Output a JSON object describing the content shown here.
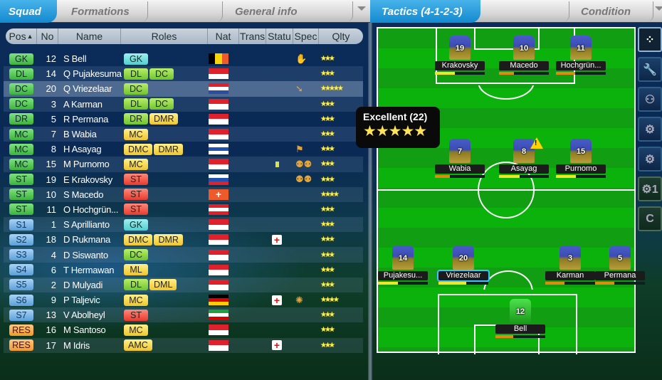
{
  "left_tabs": {
    "squad": "Squad",
    "formations": "Formations",
    "general_info": "General info"
  },
  "columns": [
    "Pos",
    "No",
    "Name",
    "Roles",
    "Nat",
    "Trans",
    "Statu",
    "Spec",
    "Qlty"
  ],
  "players": [
    {
      "pos": "GK",
      "pos_color": "green",
      "no": "12",
      "name": "S Bell",
      "roles": [
        {
          "r": "GK",
          "c": "cyan"
        }
      ],
      "flag": {
        "dir": "v",
        "colors": [
          "#000000",
          "#f8d40a",
          "#ef5a2a"
        ]
      },
      "spec": "gloves-icon",
      "stars": 3
    },
    {
      "pos": "DL",
      "pos_color": "green",
      "no": "14",
      "name": "Q Pujakesuma",
      "roles": [
        {
          "r": "DL",
          "c": "lgreen"
        },
        {
          "r": "DC",
          "c": "lgreen"
        }
      ],
      "flag": {
        "dir": "h",
        "colors": [
          "#e0202a",
          "#ffffff"
        ]
      },
      "stars": 2.5
    },
    {
      "pos": "DC",
      "pos_color": "green",
      "no": "20",
      "name": "Q Vriezelaar",
      "roles": [
        {
          "r": "DC",
          "c": "lgreen"
        }
      ],
      "flag": {
        "dir": "h",
        "colors": [
          "#e0202a",
          "#ffffff",
          "#2a4ea0"
        ]
      },
      "spec": "tackle-icon",
      "stars": 4.5,
      "selected": true
    },
    {
      "pos": "DC",
      "pos_color": "green",
      "no": "3",
      "name": "A Karman",
      "roles": [
        {
          "r": "DL",
          "c": "lgreen"
        },
        {
          "r": "DC",
          "c": "lgreen"
        }
      ],
      "flag": {
        "dir": "h",
        "colors": [
          "#e0202a",
          "#ffffff"
        ]
      },
      "stars": 2.5
    },
    {
      "pos": "DR",
      "pos_color": "green",
      "no": "5",
      "name": "R Permana",
      "roles": [
        {
          "r": "DR",
          "c": "lgreen"
        },
        {
          "r": "DMR",
          "c": "yellow"
        }
      ],
      "flag": {
        "dir": "h",
        "colors": [
          "#e0202a",
          "#ffffff"
        ]
      },
      "stars": 2.5
    },
    {
      "pos": "MC",
      "pos_color": "green",
      "no": "7",
      "name": "B Wabia",
      "roles": [
        {
          "r": "MC",
          "c": "yellow"
        }
      ],
      "flag": {
        "dir": "h",
        "colors": [
          "#e0202a",
          "#ffffff"
        ]
      },
      "stars": 2.5
    },
    {
      "pos": "MC",
      "pos_color": "green",
      "no": "8",
      "name": "H Asayag",
      "roles": [
        {
          "r": "DMC",
          "c": "yellow"
        },
        {
          "r": "DMR",
          "c": "yellow"
        }
      ],
      "flag": {
        "dir": "h",
        "colors": [
          "#ffffff",
          "#2050b0",
          "#ffffff"
        ]
      },
      "spec": "captain-flag-icon",
      "stars": 2.5
    },
    {
      "pos": "MC",
      "pos_color": "green",
      "no": "15",
      "name": "M Purnomo",
      "roles": [
        {
          "r": "MC",
          "c": "yellow"
        }
      ],
      "flag": {
        "dir": "h",
        "colors": [
          "#e0202a",
          "#ffffff"
        ]
      },
      "status": "fitness",
      "spec": "teamwork-icon",
      "stars": 2.5
    },
    {
      "pos": "ST",
      "pos_color": "green",
      "no": "19",
      "name": "E Krakovsky",
      "roles": [
        {
          "r": "ST",
          "c": "red"
        }
      ],
      "flag": {
        "dir": "h",
        "colors": [
          "#ffffff",
          "#2050b0",
          "#e0202a"
        ]
      },
      "spec": "teamwork-icon",
      "stars": 2.5
    },
    {
      "pos": "ST",
      "pos_color": "green",
      "no": "10",
      "name": "S Macedo",
      "roles": [
        {
          "r": "ST",
          "c": "red"
        }
      ],
      "flag": {
        "dir": "h",
        "colors": [
          "#ef5a2a"
        ],
        "cross": true
      },
      "stars": 3.5
    },
    {
      "pos": "ST",
      "pos_color": "green",
      "no": "11",
      "name": "O Hochgrün...",
      "roles": [
        {
          "r": "ST",
          "c": "red"
        }
      ],
      "flag": {
        "dir": "h",
        "colors": [
          "#e0202a",
          "#ffffff",
          "#e0202a"
        ]
      },
      "stars": 2.5
    },
    {
      "pos": "S1",
      "pos_color": "blue",
      "no": "1",
      "name": "S Aprillianto",
      "roles": [
        {
          "r": "GK",
          "c": "cyan"
        }
      ],
      "flag": {
        "dir": "h",
        "colors": [
          "#e0202a",
          "#ffffff"
        ]
      },
      "stars": 2.5
    },
    {
      "pos": "S2",
      "pos_color": "blue",
      "no": "18",
      "name": "D Rukmana",
      "roles": [
        {
          "r": "DMC",
          "c": "yellow"
        },
        {
          "r": "DMR",
          "c": "yellow"
        }
      ],
      "flag": {
        "dir": "h",
        "colors": [
          "#e0202a",
          "#ffffff"
        ]
      },
      "status": "injured",
      "stars": 2.5
    },
    {
      "pos": "S3",
      "pos_color": "blue",
      "no": "4",
      "name": "D Siswanto",
      "roles": [
        {
          "r": "DC",
          "c": "lgreen"
        }
      ],
      "flag": {
        "dir": "h",
        "colors": [
          "#e0202a",
          "#ffffff"
        ]
      },
      "stars": 2.5
    },
    {
      "pos": "S4",
      "pos_color": "blue",
      "no": "6",
      "name": "T Hermawan",
      "roles": [
        {
          "r": "ML",
          "c": "yellow"
        }
      ],
      "flag": {
        "dir": "h",
        "colors": [
          "#e0202a",
          "#ffffff"
        ]
      },
      "stars": 2.5
    },
    {
      "pos": "S5",
      "pos_color": "blue",
      "no": "2",
      "name": "D Mulyadi",
      "roles": [
        {
          "r": "DL",
          "c": "lgreen"
        },
        {
          "r": "DML",
          "c": "yellow"
        }
      ],
      "flag": {
        "dir": "h",
        "colors": [
          "#e0202a",
          "#ffffff"
        ]
      },
      "stars": 2.5
    },
    {
      "pos": "S6",
      "pos_color": "blue",
      "no": "9",
      "name": "P Taljevic",
      "roles": [
        {
          "r": "MC",
          "c": "yellow"
        }
      ],
      "flag": {
        "dir": "h",
        "colors": [
          "#000000",
          "#dd0000",
          "#ffce00"
        ]
      },
      "status": "injured",
      "spec": "star-player-icon",
      "stars": 3.5
    },
    {
      "pos": "S7",
      "pos_color": "blue",
      "no": "13",
      "name": "V Abolheyl",
      "roles": [
        {
          "r": "ST",
          "c": "red"
        }
      ],
      "flag": {
        "dir": "h",
        "colors": [
          "#239f40",
          "#ffffff",
          "#da0000"
        ]
      },
      "stars": 2.5
    },
    {
      "pos": "RES",
      "pos_color": "orange",
      "no": "16",
      "name": "M Santoso",
      "roles": [
        {
          "r": "MC",
          "c": "yellow"
        }
      ],
      "flag": {
        "dir": "h",
        "colors": [
          "#e0202a",
          "#ffffff"
        ]
      },
      "stars": 2.5
    },
    {
      "pos": "RES",
      "pos_color": "orange",
      "no": "17",
      "name": "M Idris",
      "roles": [
        {
          "r": "AMC",
          "c": "yellow"
        }
      ],
      "flag": {
        "dir": "h",
        "colors": [
          "#e0202a",
          "#ffffff"
        ]
      },
      "status": "injured",
      "stars": 2.5
    }
  ],
  "right_tabs": {
    "tactics": "Tactics (4-1-2-3)",
    "condition": "Condition"
  },
  "tooltip": {
    "title": "Excellent (22)",
    "stars": 5
  },
  "pitch_players": [
    {
      "no": "19",
      "name": "Krakovsky",
      "bar": 0.4,
      "bar_color": "#f2e62a",
      "row": 0,
      "col": 0
    },
    {
      "no": "10",
      "name": "Macedo",
      "bar": 0.3,
      "bar_color": "#e08a10",
      "row": 0,
      "col": 1
    },
    {
      "no": "11",
      "name": "Hochgrün...",
      "bar": 0.38,
      "bar_color": "#e08a10",
      "row": 0,
      "col": 2
    },
    {
      "no": "7",
      "name": "Wabia",
      "bar": 0.3,
      "bar_color": "#e08a10",
      "row": 1,
      "col": 0
    },
    {
      "no": "8",
      "name": "Asayag",
      "bar": 0.42,
      "bar_color": "#f2e62a",
      "row": 1,
      "col": 1,
      "warning": true
    },
    {
      "no": "15",
      "name": "Purnomo",
      "bar": 0.4,
      "bar_color": "#f2e62a",
      "row": 1,
      "col": 2
    },
    {
      "no": "14",
      "name": "Pujakesu...",
      "bar": 0.4,
      "bar_color": "#f2e62a",
      "row": 2,
      "col": 0
    },
    {
      "no": "20",
      "name": "Vriezelaar",
      "bar": 0.55,
      "bar_color": "#f2e62a",
      "row": 2,
      "col": 1,
      "selected": true
    },
    {
      "no": "3",
      "name": "Karman",
      "bar": 0.38,
      "bar_color": "#e08a10",
      "row": 2,
      "col": 2
    },
    {
      "no": "5",
      "name": "Permana",
      "bar": 0.38,
      "bar_color": "#e08a10",
      "row": 2,
      "col": 3
    },
    {
      "no": "12",
      "name": "Bell",
      "bar": 0.35,
      "bar_color": "#e08a10",
      "row": 3,
      "col": 0,
      "gk": true
    }
  ],
  "side_buttons": [
    {
      "icon": "formation-icon",
      "label": "⁘"
    },
    {
      "icon": "wrench-icon",
      "label": "🔧"
    },
    {
      "icon": "players-icon",
      "label": "⚇"
    },
    {
      "icon": "gear-settings-icon",
      "label": "⚙"
    },
    {
      "icon": "gear-icon",
      "label": "⚙"
    },
    {
      "icon": "gear-one-icon",
      "label": "⚙1"
    },
    {
      "icon": "c-icon",
      "label": "C"
    }
  ]
}
